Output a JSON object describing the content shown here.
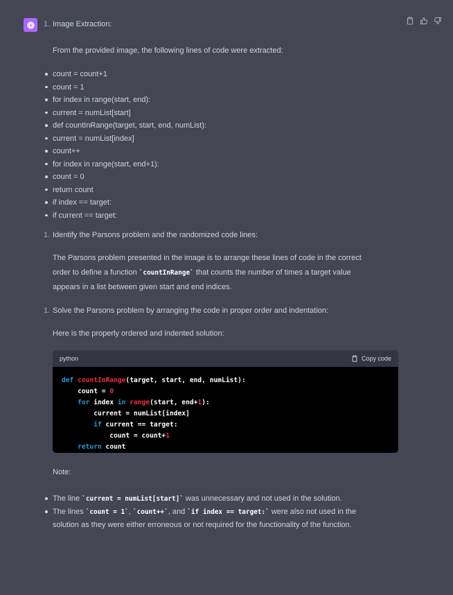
{
  "section1": {
    "number": "1.",
    "heading": "Image Extraction:",
    "intro": "From the provided image, the following lines of code were extracted:",
    "lines": [
      "count = count+1",
      "count = 1",
      "for index in range(start, end):",
      "current = numList[start]",
      "def countInRange(target, start, end, numList):",
      "current = numList[index]",
      "count++",
      "for index in range(start, end+1):",
      "count = 0",
      "return count",
      "if index == target:",
      "if current == target:"
    ]
  },
  "section2": {
    "number": "1.",
    "heading": "Identify the Parsons problem and the randomized code lines:",
    "p1": "The Parsons problem presented in the image is to arrange these lines of code in the correct",
    "p2_pre": "order to define a function ",
    "p2_code": "`countInRange`",
    "p2_post": " that counts the number of times a target value",
    "p3": "appears in a list between given start and end indices."
  },
  "section3": {
    "number": "1.",
    "heading": "Solve the Parsons problem by arranging the code in proper order and indentation:",
    "intro": "Here is the properly ordered and indented solution:"
  },
  "code": {
    "language": "python",
    "copy_label": "Copy code",
    "t": {
      "def": "def ",
      "fname": "countInRange",
      "params": "(target, start, end, numList):",
      "count_eq": "    count = ",
      "zero": "0",
      "for_kw": "    for",
      "index_sp": " index ",
      "in_kw": "in",
      "range_fn": " range",
      "range_args": "(start, end+",
      "one": "1",
      "close": "):",
      "current_line": "        current = numList[index]",
      "if_kw": "        if",
      "if_rest": " current == target:",
      "count_plus": "            count = count+",
      "one2": "1",
      "return_kw": "    return",
      "return_rest": " count"
    }
  },
  "note": {
    "label": "Note:",
    "n1_pre": "The line ",
    "n1_code": "`current = numList[start]`",
    "n1_post": " was unnecessary and not used in the solution.",
    "n2_a": "The lines ",
    "n2_c1": "`count = 1`",
    "n2_sep": ", ",
    "n2_c2": "`count++`",
    "n2_and": ", and ",
    "n2_c3": "`if index == target:`",
    "n2_post": " were also not used in the",
    "n2_l2": "solution as they were either erroneous or not required for the functionality of the function."
  }
}
